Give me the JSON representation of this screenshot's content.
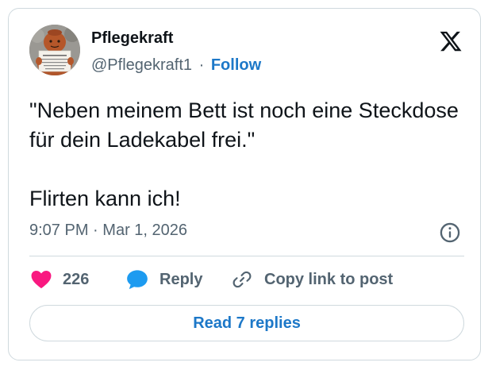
{
  "author": {
    "display_name": "Pflegekraft",
    "handle": "@Pflegekraft1",
    "separator": "·",
    "follow_label": "Follow",
    "avatar_icon": "knitted-figure-holding-sign-avatar"
  },
  "platform_icon": "x-logo-icon",
  "tweet": {
    "paragraphs": [
      "\"Neben meinem Bett ist noch eine Steckdose für dein Ladekabel frei.\"",
      "Flirten kann ich!"
    ],
    "time": "9:07 PM",
    "separator": "·",
    "date": "Mar 1, 2026"
  },
  "actions": {
    "like_count": "226",
    "reply_label": "Reply",
    "copy_link_label": "Copy link to post"
  },
  "read_replies_label": "Read 7 replies",
  "colors": {
    "like": "#f91880",
    "reply": "#1d9bf0",
    "link": "#1d78c8",
    "muted": "#536471",
    "border": "#cfd9de"
  }
}
